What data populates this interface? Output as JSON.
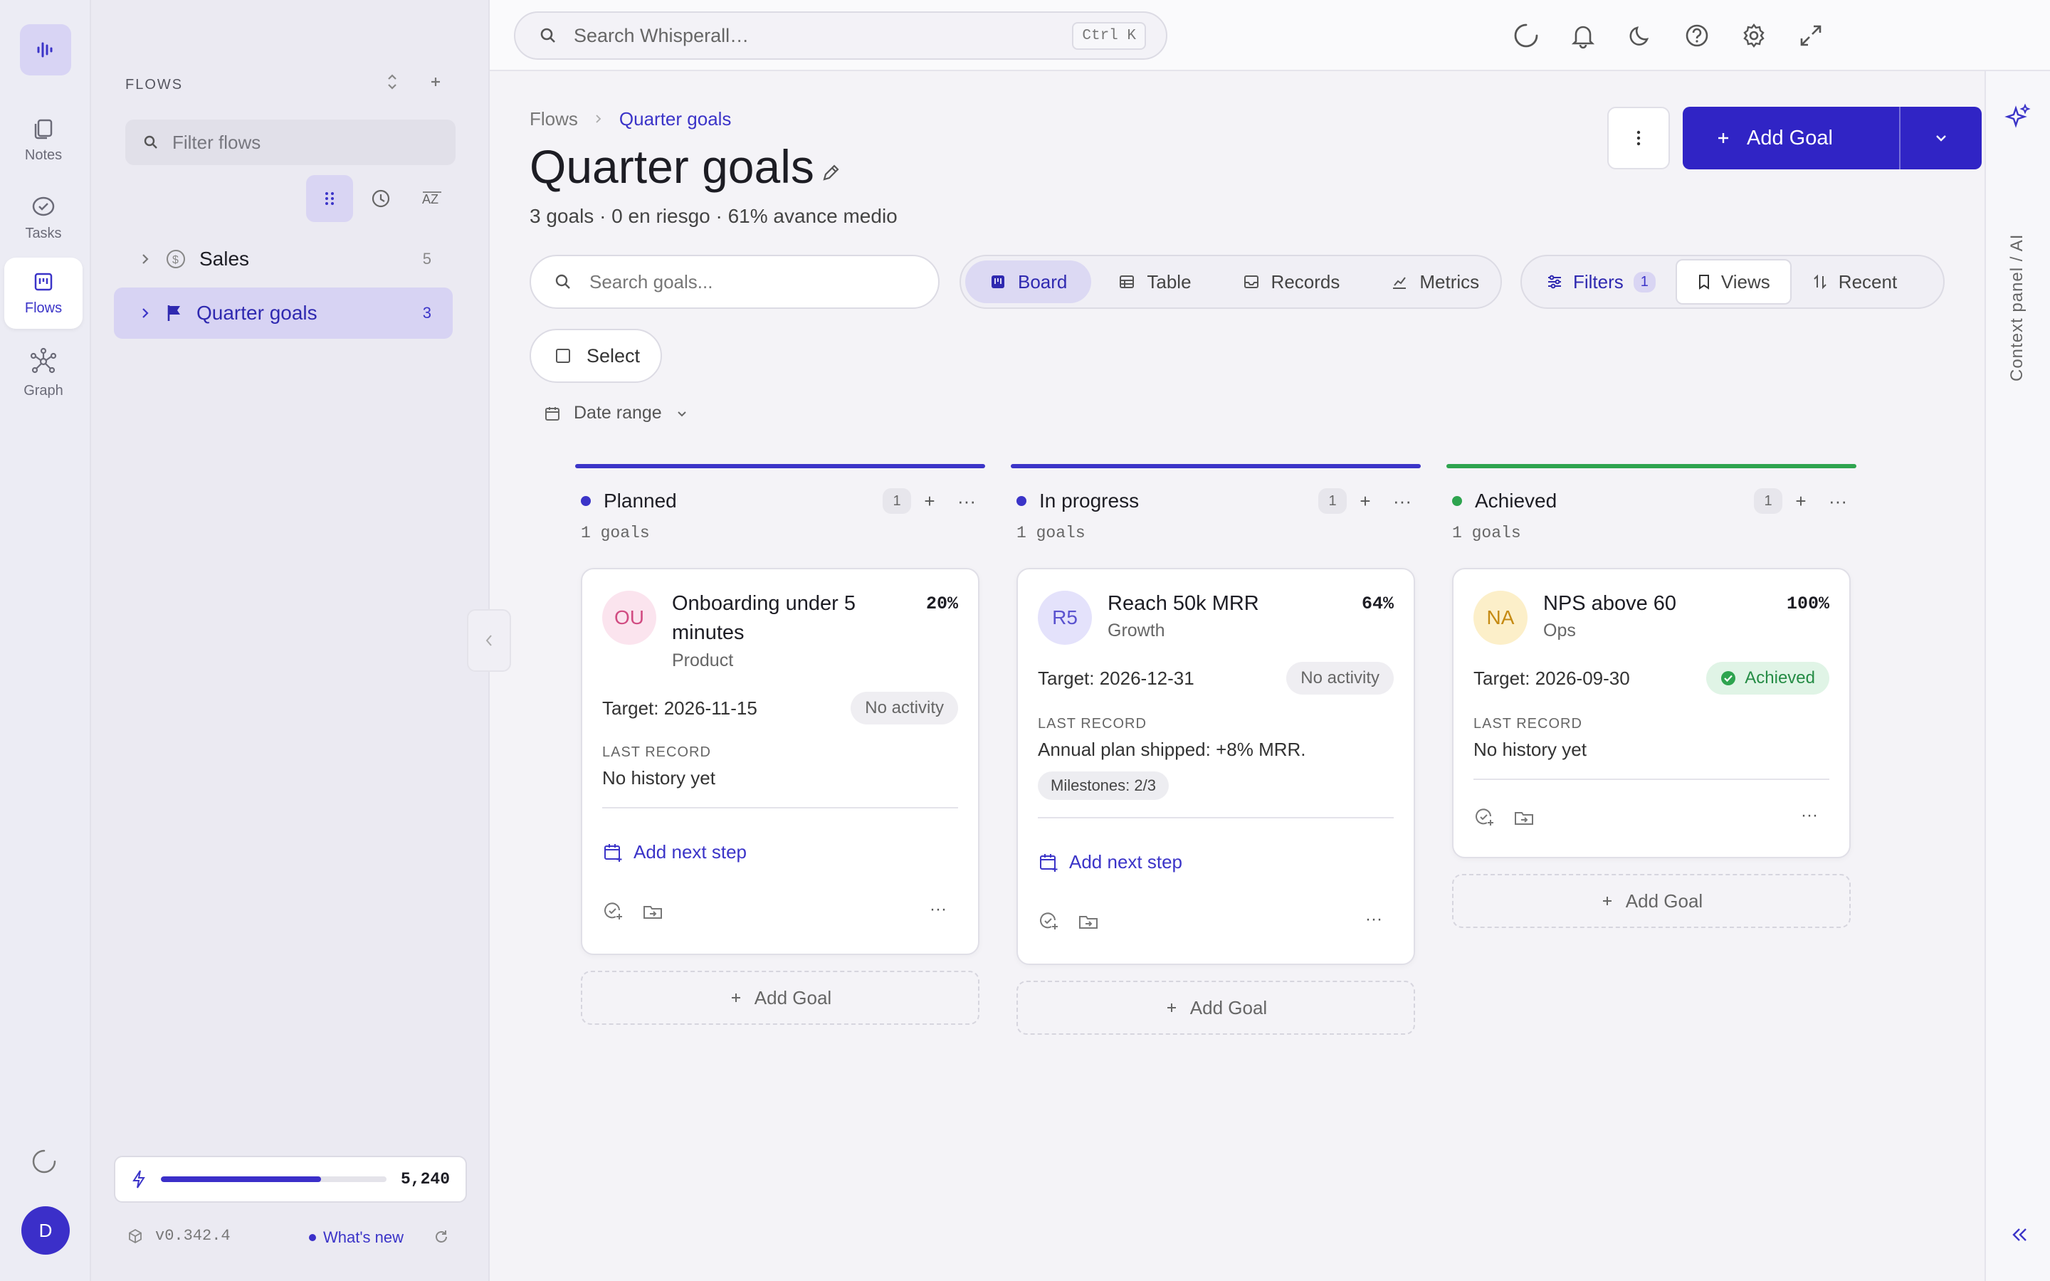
{
  "rail": {
    "nav": [
      {
        "label": "Notes",
        "icon": "notes-icon"
      },
      {
        "label": "Tasks",
        "icon": "tasks-icon"
      },
      {
        "label": "Flows",
        "icon": "flows-icon",
        "active": true
      },
      {
        "label": "Graph",
        "icon": "graph-icon"
      }
    ],
    "avatar": "D"
  },
  "sidebar": {
    "title": "FLOWS",
    "filter_placeholder": "Filter flows",
    "view_modes": [
      "drag-icon",
      "clock-icon",
      "sort-az-icon"
    ],
    "flows": [
      {
        "label": "Sales",
        "count": "5",
        "icon": "dollar-icon"
      },
      {
        "label": "Quarter goals",
        "count": "3",
        "icon": "flag-icon",
        "active": true
      }
    ],
    "credits": {
      "value": "5,240",
      "fill": 0.71
    },
    "version": "v0.342.4",
    "whats_new": "What's new"
  },
  "topbar": {
    "search_placeholder": "Search Whisperall…",
    "shortcut": "Ctrl K",
    "icons": [
      "loading-icon",
      "bell-icon",
      "moon-icon",
      "help-icon",
      "settings-icon",
      "expand-icon"
    ]
  },
  "page": {
    "breadcrumb": [
      "Flows",
      "Quarter goals"
    ],
    "title": "Quarter goals",
    "subtitle": "3 goals · 0 en riesgo · 61% avance medio",
    "add_goal": "Add Goal",
    "goal_search_placeholder": "Search goals...",
    "tabs": [
      {
        "label": "Board",
        "active": true
      },
      {
        "label": "Table"
      },
      {
        "label": "Records"
      },
      {
        "label": "Metrics"
      }
    ],
    "filters": "Filters",
    "filters_count": "1",
    "views": "Views",
    "recent": "Recent",
    "select": "Select",
    "date_range": "Date range"
  },
  "columns": [
    {
      "name": "Planned",
      "count": "1",
      "goals_label": "1 goals",
      "color": "#3b34c8",
      "card": {
        "initials": "OU",
        "title": "Onboarding under 5 minutes",
        "team": "Product",
        "percent": "20%",
        "target": "Target: 2026-11-15",
        "status": "No activity",
        "last_record_label": "LAST RECORD",
        "last_record": "No history yet",
        "next_step": "Add next step"
      },
      "add": "Add Goal"
    },
    {
      "name": "In progress",
      "count": "1",
      "goals_label": "1 goals",
      "color": "#3b34c8",
      "card": {
        "initials": "R5",
        "title": "Reach 50k MRR",
        "team": "Growth",
        "percent": "64%",
        "target": "Target: 2026-12-31",
        "status": "No activity",
        "last_record_label": "LAST RECORD",
        "last_record": "Annual plan shipped: +8% MRR.",
        "milestones": "Milestones: 2/3",
        "next_step": "Add next step"
      },
      "add": "Add Goal"
    },
    {
      "name": "Achieved",
      "count": "1",
      "goals_label": "1 goals",
      "color": "#2ea44f",
      "card": {
        "initials": "NA",
        "title": "NPS above 60",
        "team": "Ops",
        "percent": "100%",
        "target": "Target: 2026-09-30",
        "status": "Achieved",
        "last_record_label": "LAST RECORD",
        "last_record": "No history yet"
      },
      "add": "Add Goal"
    }
  ],
  "context_panel": {
    "label": "Context panel / AI"
  }
}
